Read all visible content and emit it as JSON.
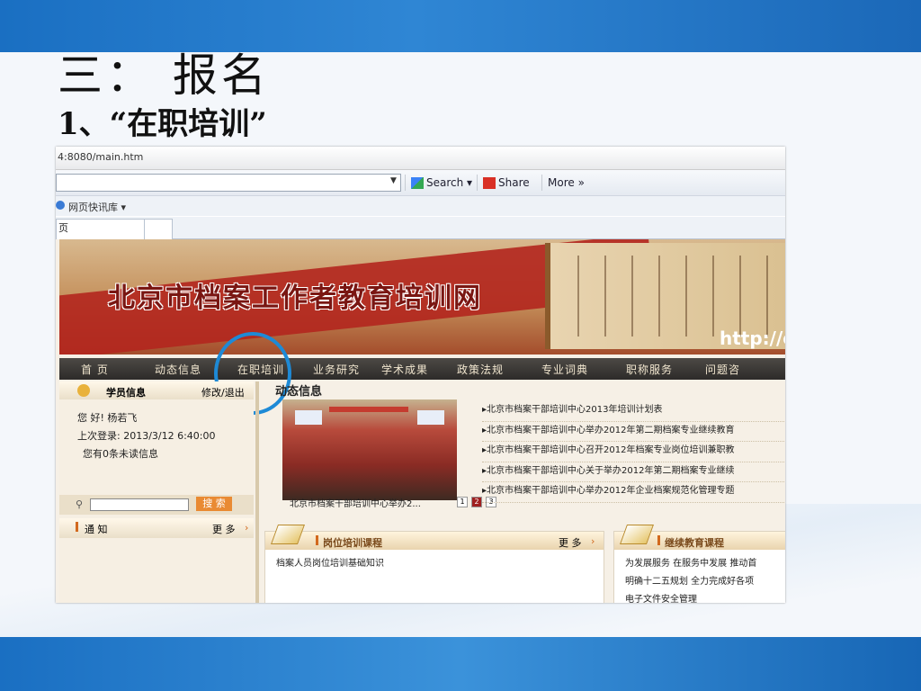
{
  "slide": {
    "title": "三： 报名",
    "subtitle": "1、“在职培训”"
  },
  "browser": {
    "address": "4:8080/main.htm",
    "toolbar": {
      "search_label": "Search",
      "share_label": "Share",
      "more_label": "More »"
    },
    "favorites_label": "网页快讯库 ▾",
    "tab_label": "页"
  },
  "site": {
    "name": "北京市档案工作者教育培训网",
    "url_fragment": "http://e",
    "nav": [
      "首 页",
      "动态信息",
      "在职培训",
      "业务研究",
      "学术成果",
      "政策法规",
      "专业词典",
      "职称服务",
      "问题咨"
    ],
    "user_panel": {
      "title": "学员信息",
      "action": "修改/退出",
      "greeting": "您 好! 杨若飞",
      "last_login": "上次登录: 2013/3/12 6:40:00",
      "unread": "您有0条未读信息"
    },
    "search_button": "搜 索",
    "notice": {
      "title": "通 知",
      "more": "更 多"
    },
    "news": {
      "title": "动态信息",
      "photo_caption": "北京市档案干部培训中心举办2...",
      "pages": [
        "1",
        "2",
        "3"
      ],
      "items": [
        "北京市档案干部培训中心2013年培训计划表",
        "北京市档案干部培训中心举办2012年第二期档案专业继续教育",
        "北京市档案干部培训中心召开2012年档案专业岗位培训兼职教",
        "北京市档案干部培训中心关于举办2012年第二期档案专业继续",
        "北京市档案干部培训中心举办2012年企业档案规范化管理专题"
      ]
    },
    "courses": {
      "post": {
        "title": "岗位培训课程",
        "more": "更 多",
        "lines": [
          "档案人员岗位培训基础知识"
        ]
      },
      "continuing": {
        "title": "继续教育课程",
        "lines": [
          "为发展服务 在服务中发展 推动首",
          "明确十二五规划 全力完成好各项",
          "电子文件安全管理"
        ]
      }
    }
  },
  "colors": {
    "slide_band": "#2f86d4",
    "highlight_circle": "#1e8ad6",
    "nav_bar": "#3a3734",
    "site_title": "#7a1612"
  }
}
